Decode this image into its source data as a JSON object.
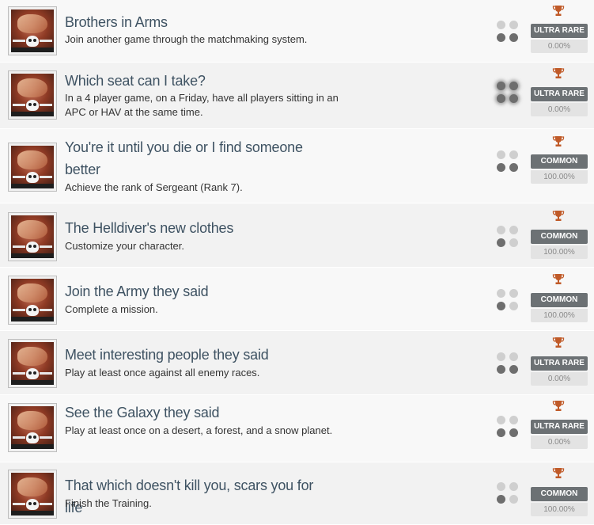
{
  "colors": {
    "trophy": "#c05a28",
    "rarity_badge": "#6c7174",
    "title_text": "#3e5262",
    "dot_active": "#6e6e6e",
    "dot_inactive": "#cfcfcf"
  },
  "achievements": [
    {
      "title": "Brothers in Arms",
      "description": "Join another game through the matchmaking system.",
      "rarity": "ULTRA RARE",
      "percent": "0.00%",
      "icon": "handshake-icon",
      "dots": [
        false,
        false,
        true,
        true
      ]
    },
    {
      "title": "Which seat can I take?",
      "description": "In a 4 player game, on a Friday, have all players sitting in an APC or HAV at the same time.",
      "rarity": "ULTRA RARE",
      "percent": "0.00%",
      "icon": "vehicle-icon",
      "dots": [
        true,
        true,
        true,
        true
      ]
    },
    {
      "title": "You're it until you die or I find someone better",
      "description": "Achieve the rank of Sergeant (Rank 7).",
      "rarity": "COMMON",
      "percent": "100.00%",
      "icon": "sergeant-icon",
      "dots": [
        false,
        false,
        true,
        true
      ]
    },
    {
      "title": "The Helldiver's new clothes",
      "description": "Customize your character.",
      "rarity": "COMMON",
      "percent": "100.00%",
      "icon": "customize-icon",
      "dots": [
        false,
        false,
        true,
        false
      ]
    },
    {
      "title": "Join the Army they said",
      "description": "Complete a mission.",
      "rarity": "COMMON",
      "percent": "100.00%",
      "icon": "mission-icon",
      "dots": [
        false,
        false,
        true,
        false
      ]
    },
    {
      "title": "Meet interesting people they said",
      "description": "Play at least once against all enemy races.",
      "rarity": "ULTRA RARE",
      "percent": "0.00%",
      "icon": "enemy-races-icon",
      "dots": [
        false,
        false,
        true,
        true
      ]
    },
    {
      "title": "See the Galaxy they said",
      "description": "Play at least once on a desert, a forest, and a snow planet.",
      "rarity": "ULTRA RARE",
      "percent": "0.00%",
      "icon": "galaxy-icon",
      "dots": [
        false,
        false,
        true,
        true
      ]
    },
    {
      "title": "That which doesn't kill you, scars you for life",
      "description": "Finish the Training.",
      "rarity": "COMMON",
      "percent": "100.00%",
      "icon": "training-icon",
      "dots": [
        false,
        false,
        true,
        false
      ]
    }
  ]
}
